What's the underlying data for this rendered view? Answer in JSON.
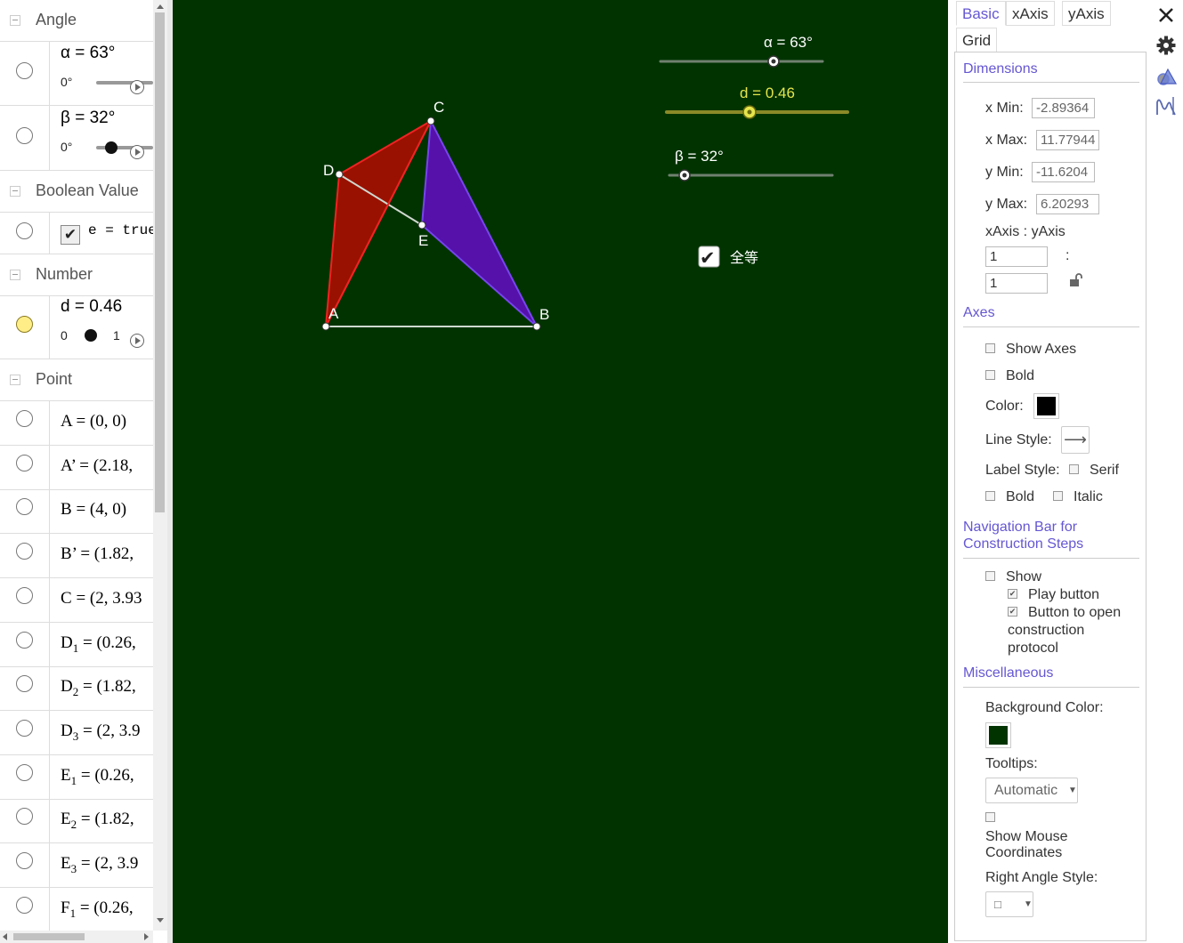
{
  "algebra": {
    "groups": {
      "angle": "Angle",
      "boolean": "Boolean Value",
      "number": "Number",
      "point": "Point"
    },
    "alpha": {
      "def": "α = 63°",
      "min": "0°",
      "value": 63
    },
    "beta": {
      "def": "β = 32°",
      "min": "0°",
      "value": 32
    },
    "e": {
      "check": "✔",
      "def": "e = true"
    },
    "d": {
      "def": "d = 0.46",
      "min": "0",
      "max": "1",
      "value": 0.46
    },
    "points": [
      {
        "name": "A",
        "sub": "",
        "rest": " = (0, 0)"
      },
      {
        "name": "A’",
        "sub": "",
        "rest": " = (2.18,"
      },
      {
        "name": "B",
        "sub": "",
        "rest": " = (4, 0)"
      },
      {
        "name": "B’",
        "sub": "",
        "rest": " = (1.82,"
      },
      {
        "name": "C",
        "sub": "",
        "rest": " = (2, 3.93"
      },
      {
        "name": "D",
        "sub": "1",
        "rest": " = (0.26,"
      },
      {
        "name": "D",
        "sub": "2",
        "rest": " = (1.82,"
      },
      {
        "name": "D",
        "sub": "3",
        "rest": " = (2, 3.9"
      },
      {
        "name": "E",
        "sub": "1",
        "rest": " = (0.26,"
      },
      {
        "name": "E",
        "sub": "2",
        "rest": " = (1.82,"
      },
      {
        "name": "E",
        "sub": "3",
        "rest": " = (2, 3.9"
      },
      {
        "name": "F",
        "sub": "1",
        "rest": " = (0.26,"
      }
    ]
  },
  "graphics": {
    "background": "#003300",
    "sliders": {
      "alpha": {
        "label": "α = 63°",
        "color": "#ffffff"
      },
      "d": {
        "label": "d = 0.46",
        "color": "#e6e64c"
      },
      "beta": {
        "label": "β = 32°",
        "color": "#ffffff"
      }
    },
    "checkbox": {
      "label": "全等",
      "check": "✔"
    },
    "points": {
      "A": "A",
      "B": "B",
      "C": "C",
      "D": "D",
      "E": "E"
    },
    "colors": {
      "red": "#ee2222",
      "red_fill": "#991100",
      "purple": "#7744ee",
      "purple_fill": "#5511aa",
      "segment": "#cfd8cf"
    }
  },
  "properties": {
    "tabs": {
      "basic": "Basic",
      "xaxis": "xAxis",
      "yaxis": "yAxis",
      "grid": "Grid"
    },
    "dimensions": {
      "title": "Dimensions",
      "xmin_label": "x Min:",
      "xmin": "-2.89364",
      "xmax_label": "x Max:",
      "xmax": "11.77944",
      "ymin_label": "y Min:",
      "ymin": "-11.6204",
      "ymax_label": "y Max:",
      "ymax": "6.20293",
      "ratio_label": "xAxis : yAxis",
      "ratio_x": "1",
      "ratio_sep": ":",
      "ratio_y": "1"
    },
    "axes": {
      "title": "Axes",
      "show_axes": "Show Axes",
      "bold": "Bold",
      "color_label": "Color:",
      "color": "#000000",
      "line_style_label": "Line Style:",
      "line_style": "⟶",
      "label_style_label": "Label Style:",
      "serif": "Serif",
      "bold2": "Bold",
      "italic": "Italic"
    },
    "navigation": {
      "title_line1": "Navigation Bar for",
      "title_line2": "Construction Steps",
      "show": "Show",
      "play_button": "Play button",
      "open_line1": "Button to open",
      "open_line2": "construction",
      "open_line3": "protocol",
      "check": "✔"
    },
    "misc": {
      "title": "Miscellaneous",
      "bg_color_label": "Background Color:",
      "bg_color": "#003300",
      "tooltips_label": "Tooltips:",
      "tooltips_value": "Automatic",
      "show_mouse_line1": "Show Mouse",
      "show_mouse_line2": "Coordinates",
      "right_angle_label": "Right Angle Style:",
      "right_angle_value": "□"
    },
    "side_icons": [
      "close-icon",
      "gear-icon",
      "graphics-style-icon",
      "function-graph-icon"
    ]
  }
}
